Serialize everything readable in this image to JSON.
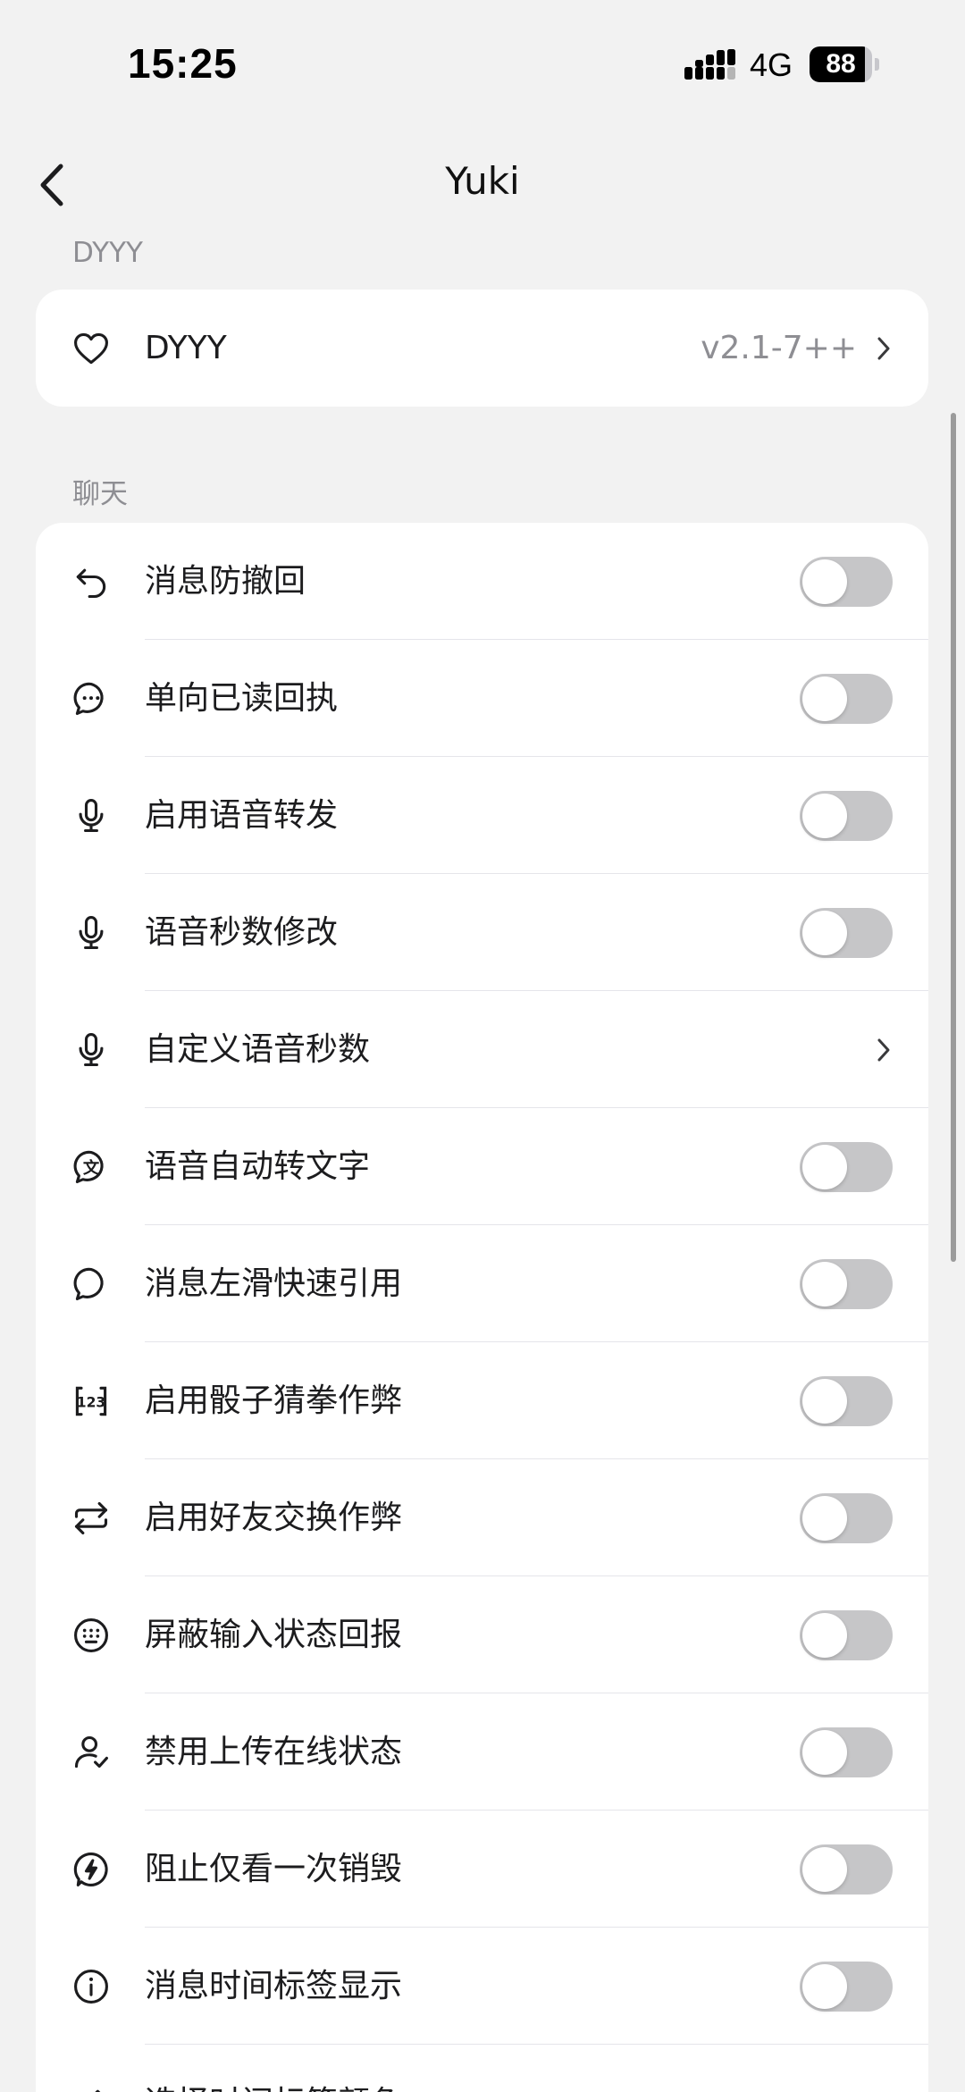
{
  "status": {
    "time": "15:25",
    "network": "4G",
    "battery": "88",
    "battery_level": 0.88
  },
  "nav": {
    "title": "Yuki"
  },
  "sections": [
    {
      "header": "DYYY",
      "rows": [
        {
          "label": "DYYY",
          "icon": "heart-icon",
          "type": "link",
          "value": "v2.1-7++"
        }
      ]
    },
    {
      "header": "聊天",
      "rows": [
        {
          "label": "消息防撤回",
          "icon": "undo-icon",
          "type": "toggle",
          "on": false
        },
        {
          "label": "单向已读回执",
          "icon": "chat-bubble-dots-icon",
          "type": "toggle",
          "on": false
        },
        {
          "label": "启用语音转发",
          "icon": "microphone-icon",
          "type": "toggle",
          "on": false
        },
        {
          "label": "语音秒数修改",
          "icon": "microphone-icon",
          "type": "toggle",
          "on": false
        },
        {
          "label": "自定义语音秒数",
          "icon": "microphone-icon",
          "type": "link"
        },
        {
          "label": "语音自动转文字",
          "icon": "translate-bubble-icon",
          "type": "toggle",
          "on": false
        },
        {
          "label": "消息左滑快速引用",
          "icon": "chat-bubble-icon",
          "type": "toggle",
          "on": false
        },
        {
          "label": "启用骰子猜拳作弊",
          "icon": "numbers-123-icon",
          "type": "toggle",
          "on": false
        },
        {
          "label": "启用好友交换作弊",
          "icon": "repeat-icon",
          "type": "toggle",
          "on": false
        },
        {
          "label": "屏蔽输入状态回报",
          "icon": "keyboard-circle-icon",
          "type": "toggle",
          "on": false
        },
        {
          "label": "禁用上传在线状态",
          "icon": "user-check-icon",
          "type": "toggle",
          "on": false
        },
        {
          "label": "阻止仅看一次销毁",
          "icon": "flash-circle-icon",
          "type": "toggle",
          "on": false
        },
        {
          "label": "消息时间标签显示",
          "icon": "info-circle-icon",
          "type": "toggle",
          "on": false
        },
        {
          "label": "选择时间标签颜色",
          "icon": "pen-icon",
          "type": "link"
        }
      ]
    }
  ]
}
